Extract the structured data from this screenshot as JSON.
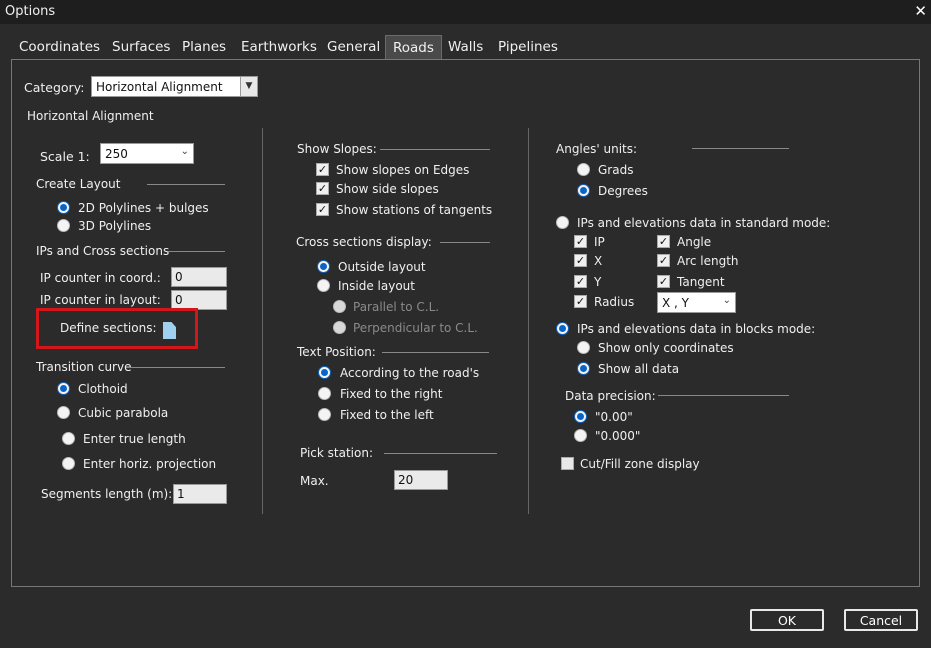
{
  "window": {
    "title": "Options",
    "close_glyph": "✕"
  },
  "tabs": [
    "Coordinates",
    "Surfaces",
    "Planes",
    "Earthworks",
    "General",
    "Roads",
    "Walls",
    "Pipelines"
  ],
  "active_tab": "Roads",
  "category": {
    "label": "Category:",
    "value": "Horizontal Alignment"
  },
  "section_title": "Horizontal Alignment",
  "col1": {
    "scale_label": "Scale 1:",
    "scale_value": "250",
    "create_layout": {
      "title": "Create Layout",
      "opt1": "2D Polylines + bulges",
      "opt2": "3D Polylines"
    },
    "ips_cross": {
      "title": "IPs and Cross sections",
      "coord_label": "IP counter in coord.:",
      "coord_value": "0",
      "layout_label": "IP counter in layout:",
      "layout_value": "0",
      "define_label": "Define sections:"
    },
    "transition": {
      "title": "Transition curve",
      "clothoid": "Clothoid",
      "cubic": "Cubic parabola",
      "true_length": "Enter true length",
      "horiz_proj": "Enter horiz. projection"
    },
    "segments_label": "Segments length (m):",
    "segments_value": "1"
  },
  "col2": {
    "show_slopes": {
      "title": "Show Slopes:",
      "edges": "Show slopes on Edges",
      "side": "Show side slopes",
      "stations": "Show stations of tangents"
    },
    "cross_display": {
      "title": "Cross sections display:",
      "outside": "Outside layout",
      "inside": "Inside layout",
      "parallel": "Parallel to C.L.",
      "perpendicular": "Perpendicular to C.L."
    },
    "text_position": {
      "title": "Text Position:",
      "according": "According to the road's",
      "right": "Fixed to the right",
      "left": "Fixed to the left"
    },
    "pick_station": {
      "title": "Pick station:",
      "max_label": "Max.",
      "max_value": "20"
    }
  },
  "col3": {
    "angles": {
      "title": "Angles' units:",
      "grads": "Grads",
      "degrees": "Degrees"
    },
    "standard_mode": "IPs and elevations data in standard mode:",
    "std_checks": {
      "ip": "IP",
      "x": "X",
      "y": "Y",
      "radius": "Radius",
      "angle": "Angle",
      "arc": "Arc length",
      "tangent": "Tangent"
    },
    "xy_value": "X , Y",
    "blocks_mode": "IPs and elevations data in blocks mode:",
    "only_coords": "Show only coordinates",
    "all_data": "Show all data",
    "precision": {
      "title": "Data precision:",
      "p2": "\"0.00\"",
      "p3": "\"0.000\""
    },
    "cutfill": "Cut/Fill zone display"
  },
  "buttons": {
    "ok": "OK",
    "cancel": "Cancel"
  },
  "colors": {
    "highlight": "#d2161a",
    "radio_accent": "#0a64c8"
  }
}
